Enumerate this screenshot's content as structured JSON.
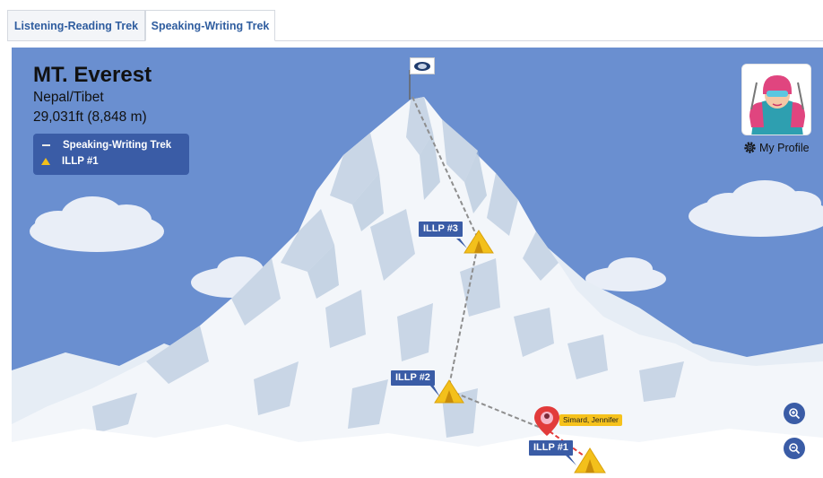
{
  "tabs": [
    {
      "label": "Listening-Reading Trek",
      "active": false
    },
    {
      "label": "Speaking-Writing Trek",
      "active": true
    }
  ],
  "mountain": {
    "name": "MT. Everest",
    "location": "Nepal/Tibet",
    "elevation": "29,031ft (8,848 m)"
  },
  "legend": {
    "trek_label": "Speaking-Writing Trek",
    "camp_label": "ILLP #1"
  },
  "profile": {
    "link_label": "My Profile",
    "icon": "gear-icon"
  },
  "camps": [
    {
      "label": "ILLP #3"
    },
    {
      "label": "ILLP #2"
    },
    {
      "label": "ILLP #1"
    }
  ],
  "climber": {
    "name": "Simard, Jennifer",
    "icon": "location-pin-icon"
  },
  "zoom": {
    "in_icon": "zoom-in-icon",
    "out_icon": "zoom-out-icon"
  },
  "colors": {
    "sky": "#6a8fd0",
    "label_bg": "#3a5ca6",
    "tent": "#f3c01b",
    "tab_text": "#2f5d9f",
    "route_done": "#e23b3b"
  }
}
